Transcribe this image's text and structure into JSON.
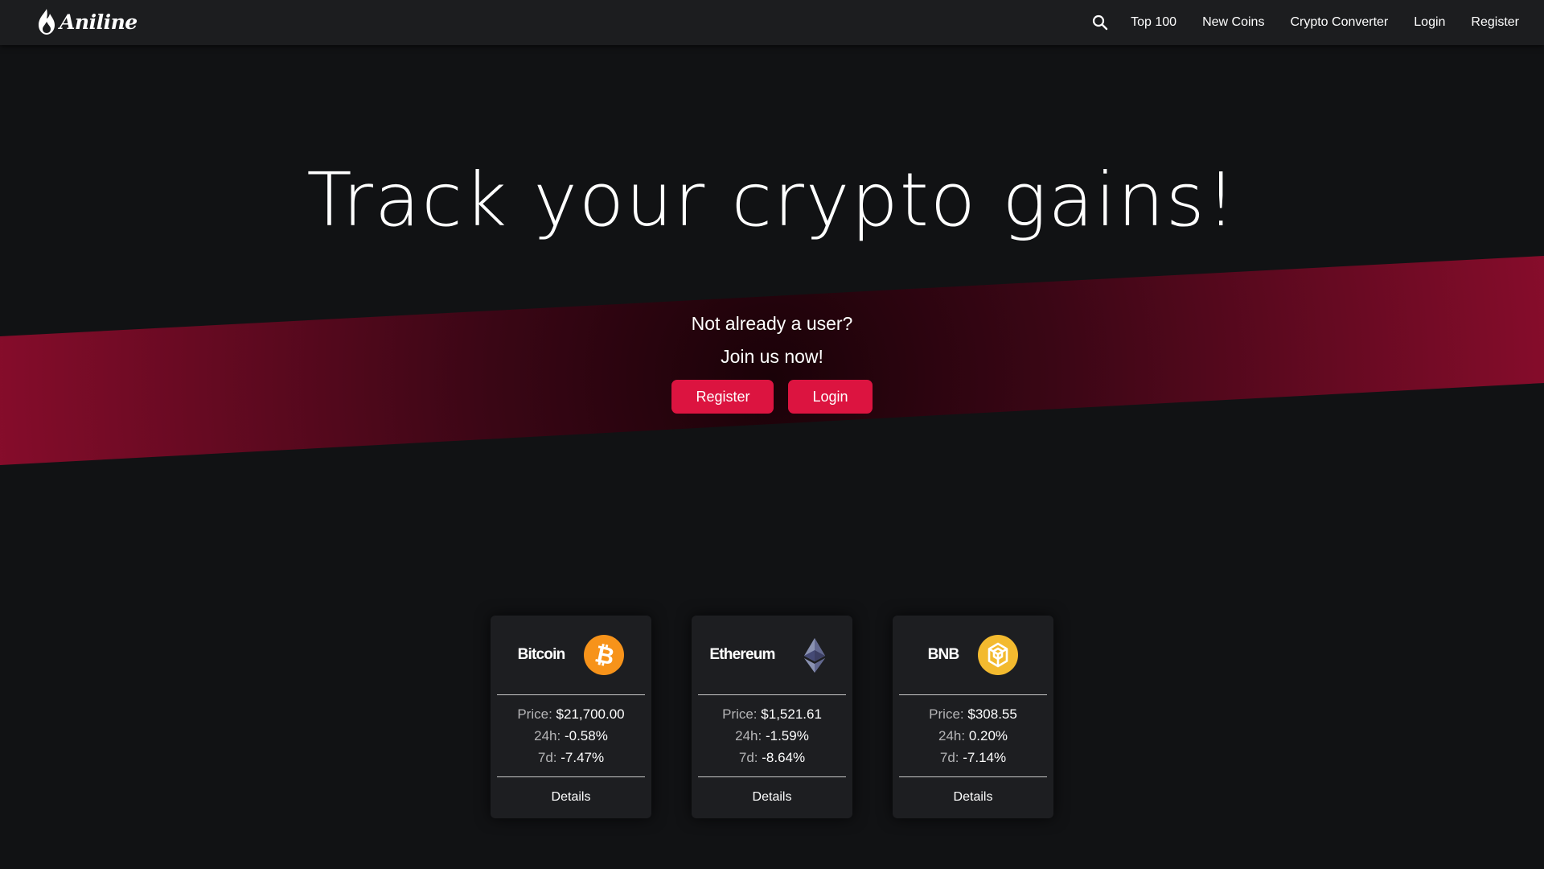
{
  "navbar": {
    "brand": "Aniline",
    "links": [
      "Top 100",
      "New Coins",
      "Crypto Converter",
      "Login",
      "Register"
    ]
  },
  "hero": {
    "title": "Track your crypto gains!",
    "cta_line1": "Not already a user?",
    "cta_line2": "Join us now!",
    "register_label": "Register",
    "login_label": "Login"
  },
  "colors": {
    "accent": "#dc1440",
    "band_dark": "#2a0410",
    "band_light": "#7a0a26",
    "background": "#111214",
    "navbar": "#1c1d1f",
    "card": "#1d1e21"
  },
  "stat_labels": {
    "price": "Price:",
    "change_24h": "24h:",
    "change_7d": "7d:"
  },
  "cards": [
    {
      "name": "Bitcoin",
      "icon": "bitcoin-icon",
      "price": "$21,700.00",
      "change_24h": "-0.58%",
      "change_7d": "-7.47%",
      "details_label": "Details"
    },
    {
      "name": "Ethereum",
      "icon": "ethereum-icon",
      "price": "$1,521.61",
      "change_24h": "-1.59%",
      "change_7d": "-8.64%",
      "details_label": "Details"
    },
    {
      "name": "BNB",
      "icon": "bnb-icon",
      "price": "$308.55",
      "change_24h": "0.20%",
      "change_7d": "-7.14%",
      "details_label": "Details"
    }
  ]
}
